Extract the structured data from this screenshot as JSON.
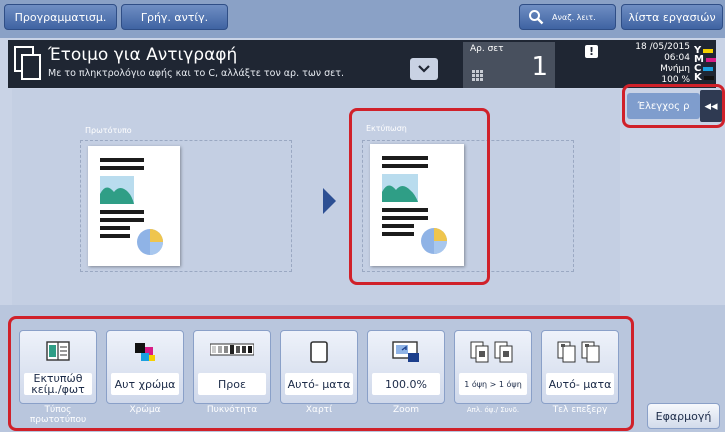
{
  "topbar": {
    "programs_label": "Προγραμματισμ.",
    "quick_copy_label": "Γρήγ. αντίγ.",
    "search_label": "Αναζ. λειτ.",
    "job_list_label": "λίστα εργασιών"
  },
  "header": {
    "title": "Έτοιμο για Αντιγραφή",
    "subtitle": "Με το πληκτρολόγιο αφής και το C, αλλάξτε τον αρ. των σετ.",
    "sets_label": "Αρ. σετ",
    "sets_value": "1",
    "warning_symbol": "!",
    "date": "18 /05/2015",
    "time": "06:04",
    "memory_label": "Μνήμη",
    "memory_value": "100 %",
    "toner": [
      {
        "letter": "Y",
        "color": "#f5d000"
      },
      {
        "letter": "M",
        "color": "#d81b86"
      },
      {
        "letter": "C",
        "color": "#1aa0e0"
      },
      {
        "letter": "K",
        "color": "#111111"
      }
    ]
  },
  "check": {
    "check_label": "Έλεγχος ρ",
    "collapse_symbol": "◂◂"
  },
  "preview": {
    "original_label": "Πρωτότυπο",
    "output_label": "Εκτύπωση"
  },
  "function_tiles": [
    {
      "value": "Εκτυπώθ κείμ./φωτ",
      "label": "Τύπος πρωτοτύπου",
      "icon": "text-photo-icon"
    },
    {
      "value": "Αυτ χρώμα",
      "label": "Χρώμα",
      "icon": "color-icon"
    },
    {
      "value": "Προε",
      "label": "Πυκνότητα",
      "icon": "density-icon"
    },
    {
      "value": "Αυτό- ματα",
      "label": "Χαρτί",
      "icon": "paper-icon"
    },
    {
      "value": "100.0%",
      "label": "Zoom",
      "icon": "zoom-icon"
    },
    {
      "value": "1 όψη > 1 όψη",
      "label": "Απλ. όψ./ Συνδ.",
      "icon": "duplex-icon"
    },
    {
      "value": "Αυτό- ματα",
      "label": "Τελ επεξεργ",
      "icon": "finishing-icon"
    }
  ],
  "apply_label": "Εφαρμογή"
}
